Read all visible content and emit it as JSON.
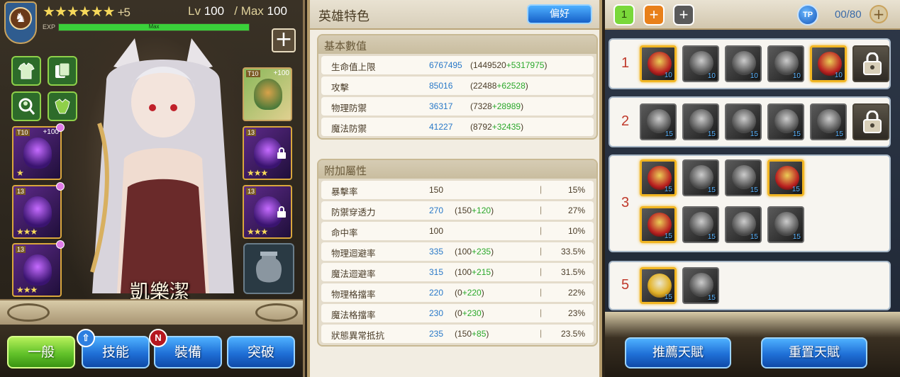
{
  "hero": {
    "stars": "★★★★★★",
    "plus": "+5",
    "level_label": "Lv",
    "level": "100",
    "max_label": "/ Max",
    "max_level": "100",
    "exp_label": "EXP",
    "exp_text": "Max",
    "exp_fraction": 1.0,
    "name": "凱樂潔"
  },
  "gear": [
    {
      "tier": "T10",
      "bonus": "+100",
      "stars": "★",
      "locked": false
    },
    {
      "tier": "T10",
      "bonus": "+100",
      "stars": "",
      "locked": false
    },
    {
      "tier": "13",
      "bonus": "",
      "stars": "★★★",
      "locked": true
    },
    {
      "tier": "13",
      "bonus": "",
      "stars": "★★★",
      "locked": false
    },
    {
      "tier": "13",
      "bonus": "",
      "stars": "★★★",
      "locked": true
    },
    {
      "tier": "13",
      "bonus": "",
      "stars": "★★★",
      "locked": false
    }
  ],
  "tabs": [
    {
      "label": "一般",
      "active": true
    },
    {
      "label": "技能",
      "badge": "⇧"
    },
    {
      "label": "裝備",
      "badge": "N"
    },
    {
      "label": "突破"
    }
  ],
  "middle": {
    "title": "英雄特色",
    "pref_button": "偏好",
    "base_title": "基本數值",
    "base_stats": [
      {
        "key": "生命值上限",
        "value": "6767495",
        "base": "1449520",
        "bonus": "+5317975"
      },
      {
        "key": "攻擊",
        "value": "85016",
        "base": "22488",
        "bonus": "+62528"
      },
      {
        "key": "物理防禦",
        "value": "36317",
        "base": "7328",
        "bonus": "+28989"
      },
      {
        "key": "魔法防禦",
        "value": "41227",
        "base": "8792",
        "bonus": "+32435"
      }
    ],
    "extra_title": "附加屬性",
    "extra_stats": [
      {
        "key": "暴擊率",
        "value": "150",
        "base": "",
        "bonus": "",
        "pct": "15%",
        "plain": true
      },
      {
        "key": "防禦穿透力",
        "value": "270",
        "base": "150",
        "bonus": "+120",
        "pct": "27%"
      },
      {
        "key": "命中率",
        "value": "100",
        "base": "",
        "bonus": "",
        "pct": "10%",
        "plain": true
      },
      {
        "key": "物理迴避率",
        "value": "335",
        "base": "100",
        "bonus": "+235",
        "pct": "33.5%"
      },
      {
        "key": "魔法迴避率",
        "value": "315",
        "base": "100",
        "bonus": "+215",
        "pct": "31.5%"
      },
      {
        "key": "物理格擋率",
        "value": "220",
        "base": "0",
        "bonus": "+220",
        "pct": "22%"
      },
      {
        "key": "魔法格擋率",
        "value": "230",
        "base": "0",
        "bonus": "+230",
        "pct": "23%"
      },
      {
        "key": "狀態異常抵抗",
        "value": "235",
        "base": "150",
        "bonus": "+85",
        "pct": "23.5%"
      }
    ],
    "sep": "|"
  },
  "right": {
    "page_num": "1",
    "page_add": "+",
    "page_add2": "+",
    "tp_label": "TP",
    "tp_count": "00/80",
    "tp_plus": "+",
    "tiers": [
      {
        "num": "1",
        "skills": [
          {
            "lvl": "10",
            "style": "red",
            "sel": true
          },
          {
            "lvl": "10",
            "style": "gray"
          },
          {
            "lvl": "10",
            "style": "gray"
          },
          {
            "lvl": "10",
            "style": "gray"
          },
          {
            "lvl": "10",
            "style": "red",
            "sel": true
          },
          {
            "lvl": "",
            "style": "locked"
          }
        ]
      },
      {
        "num": "2",
        "skills": [
          {
            "lvl": "15",
            "style": "gray"
          },
          {
            "lvl": "15",
            "style": "gray"
          },
          {
            "lvl": "15",
            "style": "gray"
          },
          {
            "lvl": "15",
            "style": "gray"
          },
          {
            "lvl": "15",
            "style": "gray"
          },
          {
            "lvl": "",
            "style": "locked"
          }
        ]
      },
      {
        "num": "3",
        "skills": [
          {
            "lvl": "15",
            "style": "red",
            "sel": true
          },
          {
            "lvl": "15",
            "style": "gray"
          },
          {
            "lvl": "15",
            "style": "gray"
          },
          {
            "lvl": "15",
            "style": "red",
            "sel": true
          },
          {
            "lvl": "15",
            "style": "red",
            "sel": true
          },
          {
            "lvl": "15",
            "style": "gray"
          },
          {
            "lvl": "15",
            "style": "gray"
          },
          {
            "lvl": "15",
            "style": "gray"
          }
        ]
      },
      {
        "num": "5",
        "skills": [
          {
            "lvl": "15",
            "style": "gold",
            "sel": true
          },
          {
            "lvl": "15",
            "style": "gray"
          }
        ]
      }
    ],
    "recommend_button": "推薦天賦",
    "reset_button": "重置天賦"
  }
}
